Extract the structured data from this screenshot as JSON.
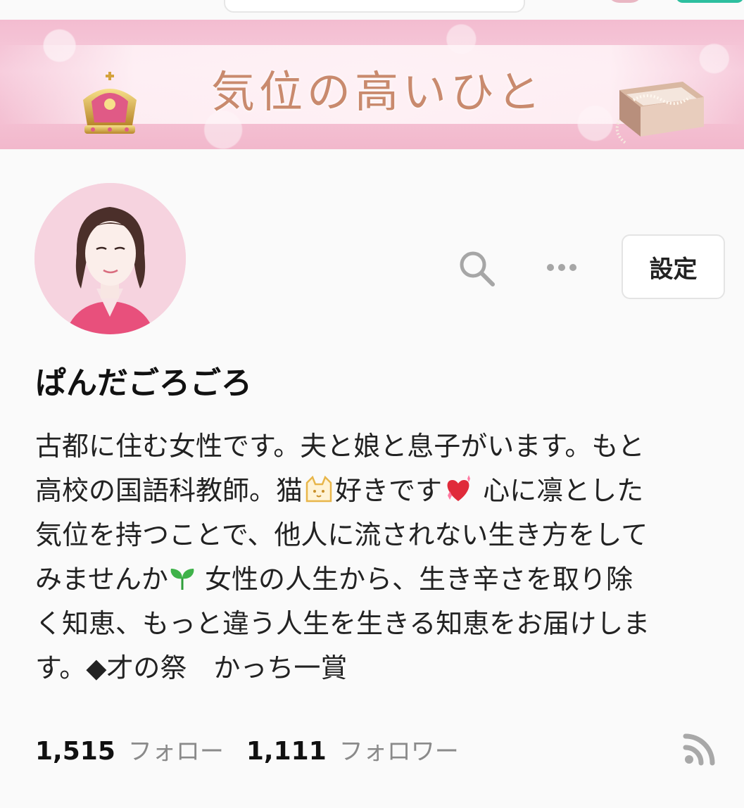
{
  "banner": {
    "title": "気位の高いひと"
  },
  "profile": {
    "name": "ぱんだごろごろ",
    "settings_label": "設定",
    "bio_lines": [
      {
        "a": "古都に住む女性です。夫と娘と息子がいます。もと"
      },
      {
        "a": "高校の国語科教師。猫",
        "b": "好きです",
        "c": " 心に凛とした"
      },
      {
        "a": "気位を持つことで、他人に流されない生き方をして"
      },
      {
        "a": "みませんか",
        "b": " 女性の人生から、生き辛さを取り除"
      },
      {
        "a": "く知恵、もっと違う人生を生きる知恵をお届けしま"
      },
      {
        "a": "す。◆才の祭　かっち一賞"
      }
    ],
    "icons": {
      "cat": "cat-face-icon",
      "heart": "sparkling-heart-icon",
      "sprout": "seedling-icon"
    }
  },
  "stats": {
    "following_count": "1,515",
    "following_label": "フォロー",
    "followers_count": "1,111",
    "followers_label": "フォロワー"
  },
  "colors": {
    "banner_pink": "#f3bcd0",
    "banner_text": "#c98a6e",
    "avatar_bg": "#f6d3df",
    "muted_text": "#8a8a8a",
    "accent_green": "#2dbf9f"
  }
}
